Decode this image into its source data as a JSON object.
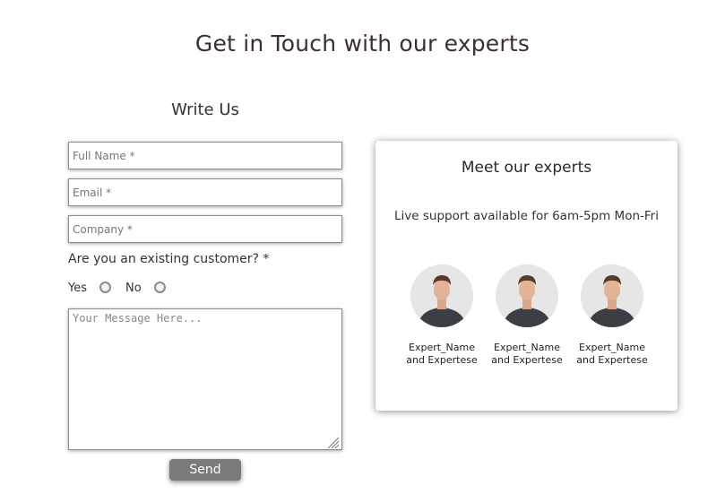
{
  "page": {
    "title": "Get in Touch with our experts"
  },
  "form": {
    "title": "Write Us",
    "full_name_placeholder": "Full Name *",
    "email_placeholder": "Email *",
    "company_placeholder": "Company *",
    "customer_question": "Are you an existing customer? *",
    "yes_label": "Yes",
    "no_label": "No",
    "message_placeholder": "Your Message Here...",
    "send_label": "Send"
  },
  "experts": {
    "title": "Meet our experts",
    "subtitle": "Live support available for 6am-5pm Mon-Fri",
    "list": [
      {
        "name": "Expert_Name",
        "expertise": "and Expertese"
      },
      {
        "name": "Expert_Name",
        "expertise": "and Expertese"
      },
      {
        "name": "Expert_Name",
        "expertise": "and Expertese"
      }
    ]
  },
  "colors": {
    "title_text": "#3d2f2f",
    "send_button": "#7a7a7a",
    "field_border": "#8a8a8a"
  }
}
